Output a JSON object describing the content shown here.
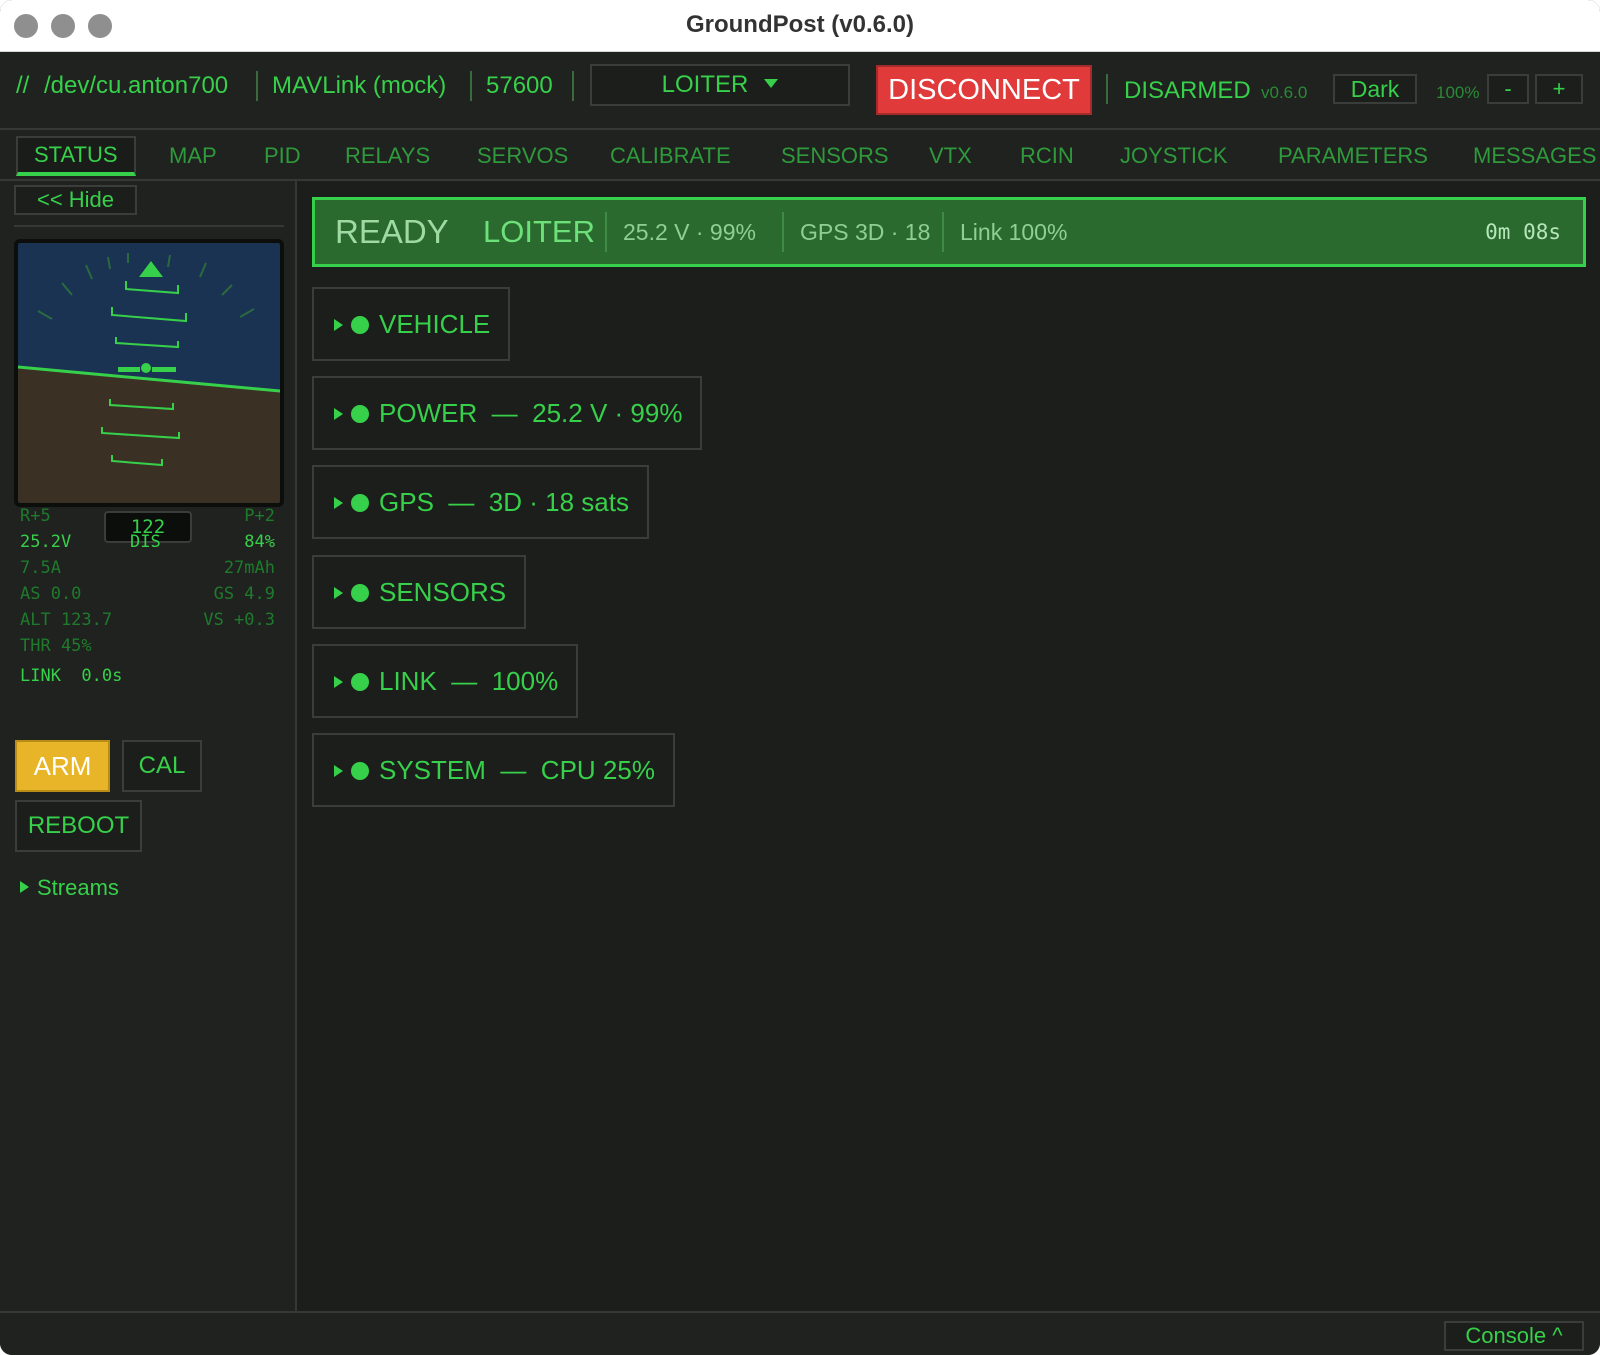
{
  "window": {
    "title": "GroundPost (v0.6.0)"
  },
  "toolbar": {
    "port_prefix": "//",
    "port": "/dev/cu.anton700",
    "protocol": "MAVLink (mock)",
    "baud": "57600",
    "mode": "LOITER",
    "disconnect_label": "DISCONNECT",
    "arm_state": "DISARMED",
    "version": "v0.6.0",
    "theme_label": "Dark",
    "zoom": "100%",
    "zoom_out_label": "-",
    "zoom_in_label": "+"
  },
  "tabs": [
    "STATUS",
    "MAP",
    "PID",
    "RELAYS",
    "SERVOS",
    "CALIBRATE",
    "SENSORS",
    "VTX",
    "RCIN",
    "JOYSTICK",
    "PARAMETERS",
    "MESSAGES"
  ],
  "sidebar": {
    "hide_label": "<< Hide",
    "roll": "R+5",
    "pitch": "P+2",
    "heading": "122",
    "voltage": "25.2V",
    "arm_short": "DIS",
    "battery_pct": "84%",
    "current": "7.5A",
    "consumed": "27mAh",
    "airspeed": "AS 0.0",
    "groundspeed": "GS 4.9",
    "altitude": "ALT 123.7",
    "vspeed": "VS +0.3",
    "throttle": "THR 45%",
    "link": "LINK  0.0s",
    "arm_label": "ARM",
    "cal_label": "CAL",
    "reboot_label": "REBOOT",
    "streams_label": "Streams"
  },
  "status_bar": {
    "state": "READY",
    "mode": "LOITER",
    "power": "25.2 V · 99%",
    "gps": "GPS 3D · 18",
    "link": "Link 100%",
    "timer": "0m 08s"
  },
  "sections": [
    {
      "label": "VEHICLE"
    },
    {
      "label": "POWER  —  25.2 V · 99%"
    },
    {
      "label": "GPS  —  3D · 18 sats"
    },
    {
      "label": "SENSORS"
    },
    {
      "label": "LINK  —  100%"
    },
    {
      "label": "SYSTEM  —  CPU 25%"
    }
  ],
  "footer": {
    "console_label": "Console ^"
  },
  "colors": {
    "accent": "#37d04a",
    "background": "#1c1e1c",
    "danger": "#e03a3a",
    "warning": "#e8b528",
    "status_bar": "#2a6a2f",
    "sky": "#1a3352",
    "ground": "#3a3124"
  },
  "icons": {
    "window_controls": "traffic-light-icon",
    "mode_dropdown": "chevron-down-icon",
    "section_expander": "triangle-right-icon",
    "section_status": "status-dot-icon",
    "horizon_marker": "heading-triangle-icon"
  }
}
